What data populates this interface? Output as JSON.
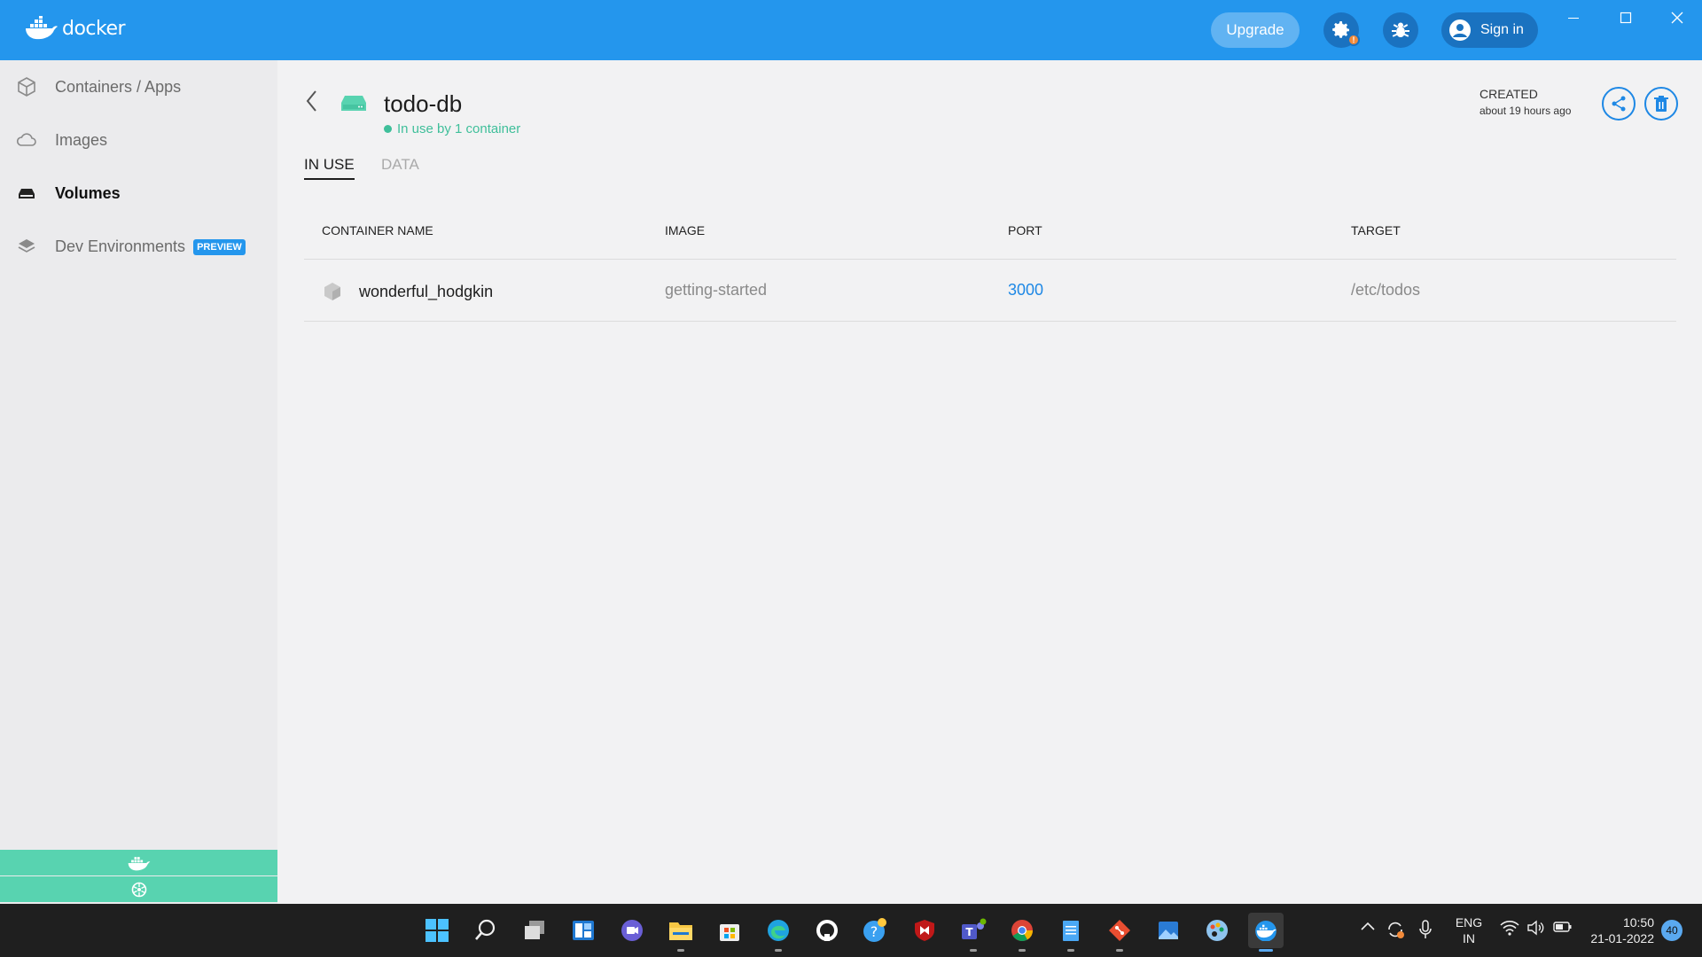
{
  "app": {
    "logo_text": "docker",
    "upgrade_label": "Upgrade",
    "settings_badge": "!",
    "signin_label": "Sign in"
  },
  "sidebar": {
    "items": [
      {
        "label": "Containers / Apps",
        "icon": "cube-icon"
      },
      {
        "label": "Images",
        "icon": "cloud-icon"
      },
      {
        "label": "Volumes",
        "icon": "disk-icon"
      },
      {
        "label": "Dev Environments",
        "icon": "layers-icon",
        "badge": "PREVIEW"
      }
    ]
  },
  "volume": {
    "name": "todo-db",
    "status": "In use by 1 container",
    "created_label": "CREATED",
    "created_value": "about 19 hours ago"
  },
  "tabs": [
    {
      "label": "IN USE",
      "active": true
    },
    {
      "label": "DATA",
      "active": false
    }
  ],
  "table": {
    "headers": [
      "CONTAINER NAME",
      "IMAGE",
      "PORT",
      "TARGET"
    ],
    "rows": [
      {
        "name": "wonderful_hodgkin",
        "image": "getting-started",
        "port": "3000",
        "target": "/etc/todos"
      }
    ]
  },
  "taskbar": {
    "lang_line1": "ENG",
    "lang_line2": "IN",
    "time": "10:50",
    "date": "21-01-2022",
    "notifications": "40"
  },
  "colors": {
    "accent": "#2496ed",
    "success": "#3fbf9a",
    "link": "#1e88e5",
    "bottom_bar": "#58d3b0"
  }
}
